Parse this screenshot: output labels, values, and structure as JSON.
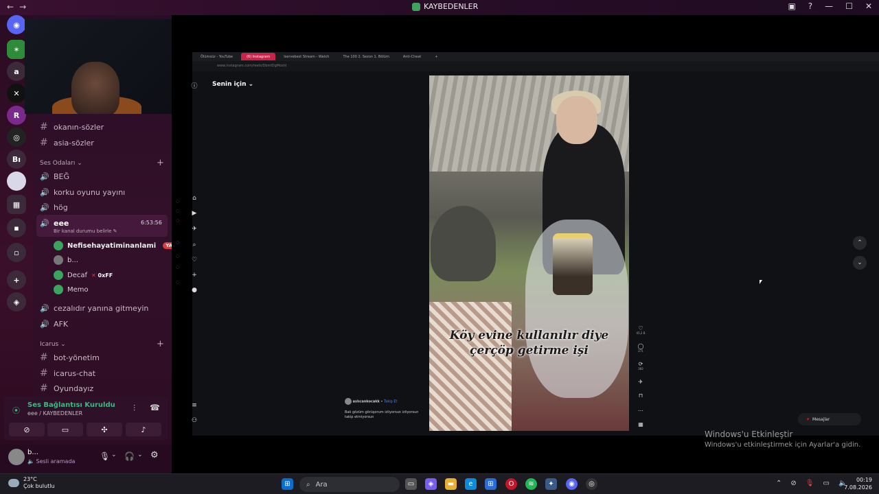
{
  "window": {
    "title": "KAYBEDENLER",
    "nav_back": "←",
    "nav_fwd": "→"
  },
  "servers": [
    {
      "label": "a"
    },
    {
      "label": "Bı"
    }
  ],
  "channels": {
    "text_channels": [
      "okanın-sözler",
      "asia-sözler"
    ],
    "voice_category": "Ses Odaları",
    "voice_channels_top": [
      "BEĞ",
      "korku oyunu yayını",
      "hög"
    ],
    "active_channel": {
      "name": "eee",
      "timer": "6:53:56",
      "status": "Bir kanal durumu belirle"
    },
    "members": [
      {
        "name": "Nefisehayatiminanlami",
        "badge": "YAYINDA"
      },
      {
        "name": "b..."
      },
      {
        "name": "Decaf",
        "tag": "0xFF"
      },
      {
        "name": "Memo"
      }
    ],
    "voice_channels_bottom": [
      "cezalıdır yanına gitmeyin",
      "AFK"
    ],
    "icarus_category": "Icarus",
    "icarus_channels": [
      "bot-yönetim",
      "icarus-chat",
      "Oyundayız"
    ]
  },
  "voice_panel": {
    "status": "Ses Bağlantısı Kuruldu",
    "location": "eee / KAYBEDENLER"
  },
  "user_panel": {
    "name": "b...",
    "status": "Sesli aramada"
  },
  "browser": {
    "tabs": [
      {
        "label": "Ölümsüz - YouTube"
      },
      {
        "label": "(6) Instagram"
      },
      {
        "label": "Iservebest Stream - Watch"
      },
      {
        "label": "The 100 2. Sezon 1. Bölüm"
      },
      {
        "label": "Anti-Cheat"
      }
    ],
    "url": "www.instagram.com/reels/DbmlDgMoshl"
  },
  "instagram": {
    "header": "Senin için",
    "caption_line1": "Köy evine kullanılır diye",
    "caption_line2": "çerçöp getirme işi",
    "likes": "45,2 B",
    "comments": "271",
    "reposts": "382",
    "author": "aslıcankocakk",
    "follow": "Takip Et",
    "post_text": "Bak gözüm görüşorum izliyorsun izliyorsun takip etmiyorsun",
    "messages": "Mesajlar"
  },
  "activation": {
    "title": "Windows'u Etkinleştir",
    "subtitle": "Windows'u etkinleştirmek için Ayarlar'a gidin."
  },
  "taskbar": {
    "temp": "23°C",
    "weather": "Çok bulutlu",
    "search": "Ara",
    "time": "00:19",
    "date": "7.08.2026"
  }
}
